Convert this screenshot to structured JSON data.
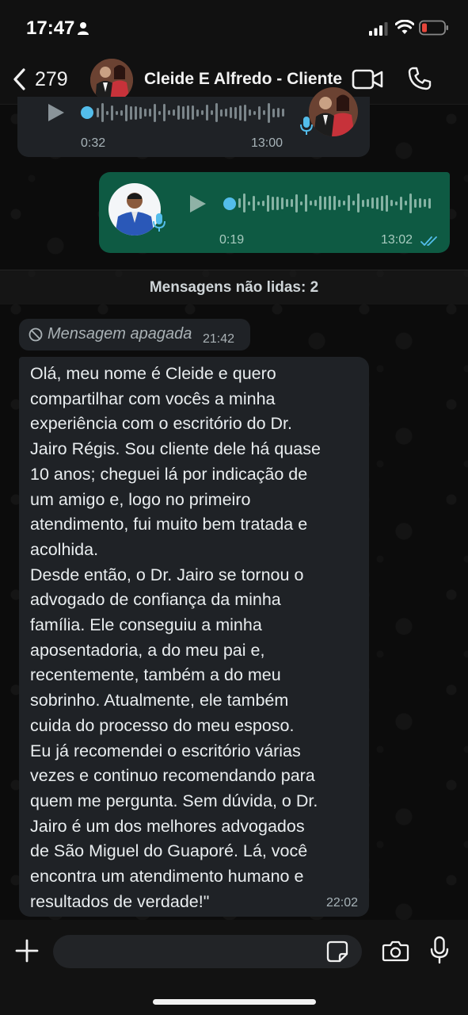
{
  "status_bar": {
    "time": "17:47"
  },
  "header": {
    "back_count": "279",
    "contact_name": "Cleide E Alfredo - Cliente"
  },
  "audio_incoming": {
    "duration": "0:32",
    "time": "13:00"
  },
  "audio_outgoing": {
    "duration": "0:19",
    "time": "13:02"
  },
  "unread": {
    "label": "Mensagens não lidas: 2"
  },
  "deleted_message": {
    "text": "Mensagem apagada",
    "time": "21:42"
  },
  "text_message": {
    "body": "Olá, meu nome é Cleide e quero\ncompartilhar com vocês a minha\nexperiência com o escritório do Dr.\nJairo Régis. Sou cliente dele há quase\n10 anos; cheguei lá por indicação de\num amigo e, logo no primeiro\natendimento, fui muito bem tratada e\nacolhida.\nDesde então, o Dr. Jairo se tornou o\nadvogado de confiança da minha\nfamília. Ele conseguiu a minha\naposentadoria, a do meu pai e,\nrecentemente, também a do meu\nsobrinho. Atualmente, ele também\ncuida do processo do meu esposo.\nEu já recomendei o escritório várias\nvezes e continuo recomendando para\nquem me pergunta. Sem dúvida, o Dr.\nJairo é um dos melhores advogados\nde São Miguel do Guaporé. Lá, você\nencontra um atendimento humano e\nresultados de verdade!\"",
    "time": "22:02"
  },
  "input_bar": {
    "message_value": ""
  },
  "colors": {
    "outgoing_bubble": "#0e5a43",
    "incoming_bubble": "#1f2226",
    "accent_blue": "#53bdeb",
    "battery_red": "#e5463b"
  },
  "icons": [
    "person-icon",
    "signal-icon",
    "wifi-icon",
    "battery-icon",
    "back-chevron-icon",
    "video-call-icon",
    "voice-call-icon",
    "play-icon",
    "mic-badge-icon",
    "read-ticks-icon",
    "deleted-icon",
    "plus-icon",
    "sticker-icon",
    "camera-icon",
    "mic-icon"
  ]
}
